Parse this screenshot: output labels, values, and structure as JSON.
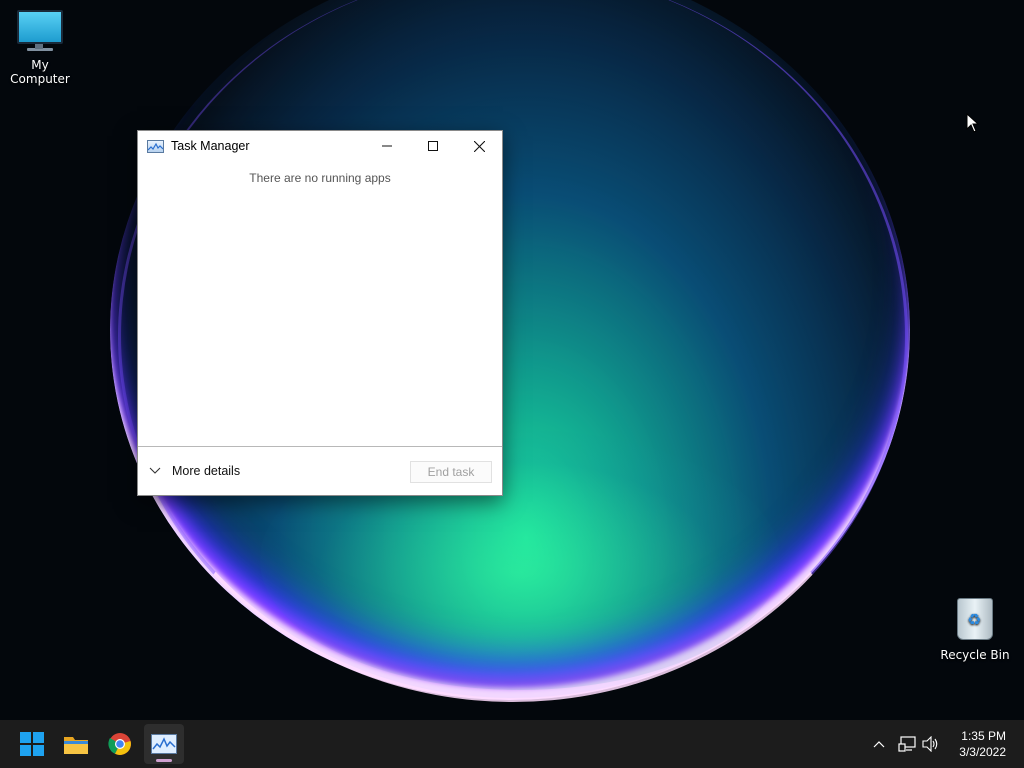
{
  "desktop": {
    "icons": [
      {
        "label": "My Computer"
      },
      {
        "label": "Recycle Bin"
      }
    ]
  },
  "window": {
    "title": "Task Manager",
    "empty_message": "There are no running apps",
    "more_details_label": "More details",
    "end_task_label": "End task"
  },
  "taskbar": {
    "items": [
      "start-icon",
      "file-explorer-icon",
      "chrome-icon",
      "task-manager-icon"
    ],
    "active_item": "task-manager-icon",
    "tray_icons": [
      "chevron-up-icon",
      "network-icon",
      "volume-icon"
    ],
    "time": "1:35 PM",
    "date": "3/3/2022"
  },
  "colors": {
    "taskbar_bg": "#1c1c1c",
    "windows_blue": "#1e9ee8"
  }
}
